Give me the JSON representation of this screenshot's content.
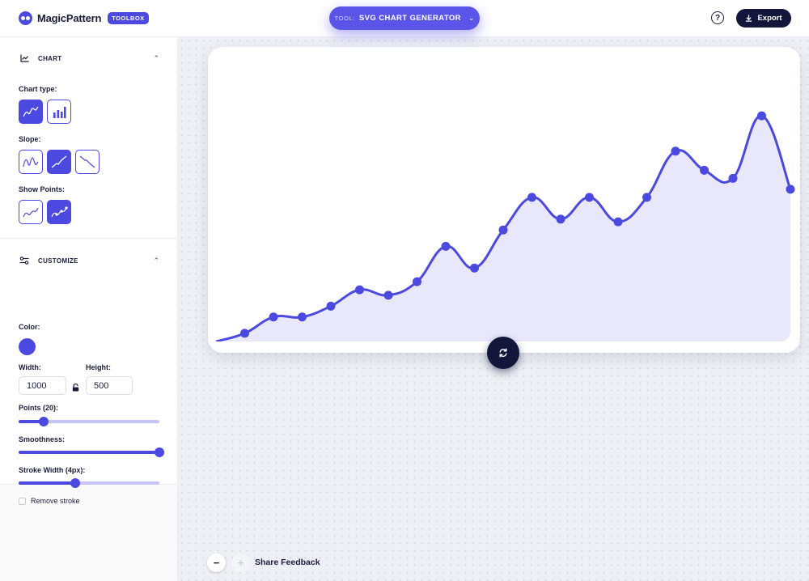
{
  "header": {
    "logo_text": "MagicPattern",
    "badge": "TOOLBOX",
    "tool_prefix": "TOOL:",
    "tool_name": "SVG CHART GENERATOR",
    "export_label": "Export"
  },
  "sidebar": {
    "chart_section": {
      "title": "CHART",
      "chart_type_label": "Chart type:",
      "chart_type_options": [
        "line",
        "bar"
      ],
      "chart_type_selected": "line",
      "slope_label": "Slope:",
      "slope_options": [
        "random",
        "up",
        "down"
      ],
      "slope_selected": "up",
      "show_points_label": "Show Points:",
      "show_points_options": [
        "off",
        "on"
      ],
      "show_points_selected": "on"
    },
    "customize_section": {
      "title": "CUSTOMIZE",
      "color_label": "Color:",
      "color_value": "#4b49e0",
      "width_label": "Width:",
      "width_value": "1000",
      "height_label": "Height:",
      "height_value": "500",
      "points_label": "Points (20):",
      "points_fraction": 0.18,
      "smoothness_label": "Smoothness:",
      "smoothness_fraction": 1.0,
      "stroke_label": "Stroke Width (4px):",
      "stroke_fraction": 0.4,
      "remove_stroke_label": "Remove stroke",
      "remove_stroke_checked": false
    }
  },
  "canvas": {
    "share_feedback": "Share Feedback"
  },
  "chart_data": {
    "type": "area",
    "series": [
      {
        "values": [
          0.0,
          0.03,
          0.09,
          0.09,
          0.13,
          0.19,
          0.17,
          0.22,
          0.35,
          0.27,
          0.41,
          0.53,
          0.45,
          0.53,
          0.44,
          0.53,
          0.7,
          0.63,
          0.6,
          0.83,
          0.56
        ]
      }
    ],
    "x_range": [
      0,
      20
    ],
    "y_range": [
      0,
      1
    ],
    "show_points": true,
    "stroke_width": 4,
    "line_color": "#4b49e0",
    "fill_color": "#e9e8fb",
    "grid": false,
    "axes": false
  }
}
